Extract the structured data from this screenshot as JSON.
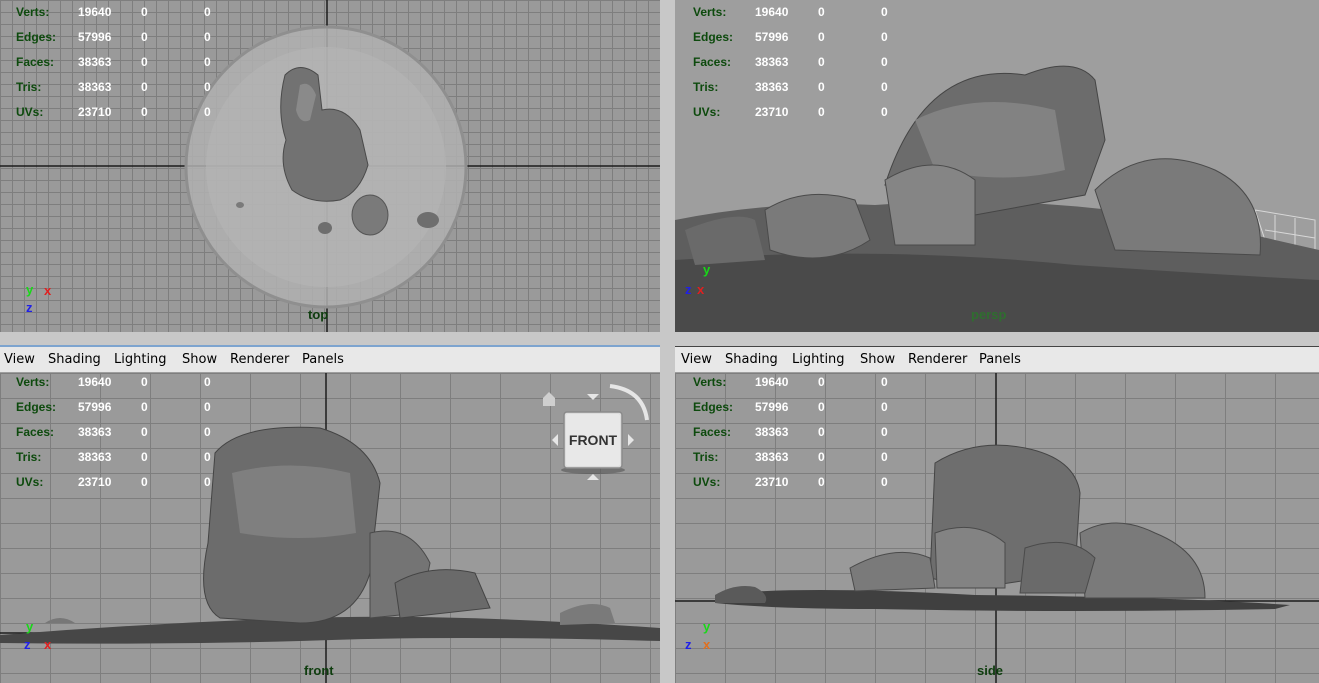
{
  "menu": [
    "View",
    "Shading",
    "Lighting",
    "Show",
    "Renderer",
    "Panels"
  ],
  "hud": {
    "labels": [
      "Verts:",
      "Edges:",
      "Faces:",
      "Tris:",
      "UVs:"
    ],
    "values": [
      "19640",
      "57996",
      "38363",
      "38363",
      "23710"
    ],
    "zero": "0"
  },
  "panels": {
    "top": {
      "camera": "top"
    },
    "persp": {
      "camera": "persp"
    },
    "front": {
      "camera": "front",
      "viewcube": "FRONT"
    },
    "side": {
      "camera": "side"
    }
  },
  "axes": {
    "x": "x",
    "y": "y",
    "z": "z"
  },
  "colors": {
    "axis_x": "#e02020",
    "axis_y": "#18d818",
    "axis_z": "#2020e8",
    "hud_label": "#0d4a0d"
  }
}
